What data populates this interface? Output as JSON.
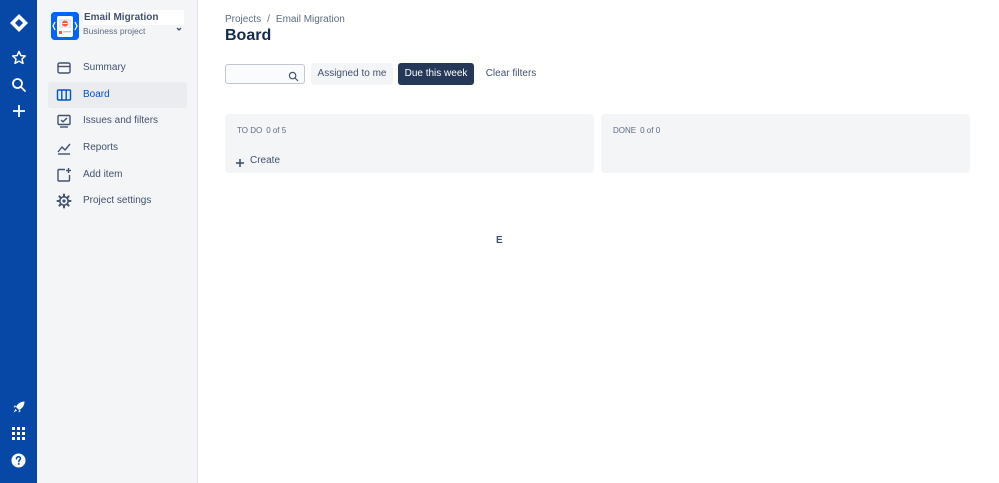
{
  "colors": {
    "global_nav_bg": "#0747a6",
    "sidebar_bg": "#f4f5f7",
    "active_blue": "#0052cc",
    "due_button_bg": "#253858"
  },
  "global_nav": {
    "icons": [
      "jira-logo-icon",
      "star-icon",
      "search-icon",
      "plus-icon",
      "rocket-icon",
      "app-switcher-icon",
      "help-icon",
      "chevron-down-icon"
    ]
  },
  "project": {
    "name": "Email Migration",
    "type": "Business project"
  },
  "sidebar": {
    "items": [
      {
        "label": "Summary",
        "icon": "summary-icon"
      },
      {
        "label": "Board",
        "icon": "board-icon"
      },
      {
        "label": "Issues and filters",
        "icon": "issues-icon"
      },
      {
        "label": "Reports",
        "icon": "reports-icon"
      },
      {
        "label": "Add item",
        "icon": "add-item-icon"
      },
      {
        "label": "Project settings",
        "icon": "gear-icon"
      }
    ],
    "active_index": 1
  },
  "breadcrumb": {
    "root": "Projects",
    "separator": "/",
    "current": "Email Migration"
  },
  "page": {
    "title": "Board"
  },
  "filters": {
    "search_value": "",
    "assigned_label": "Assigned to me",
    "due_label": "Due this week",
    "clear_label": "Clear filters"
  },
  "columns": [
    {
      "name": "TO DO",
      "count": "0 of 5",
      "create_label": "Create"
    },
    {
      "name": "DONE",
      "count": "0 of 0"
    }
  ],
  "center_text": "E"
}
